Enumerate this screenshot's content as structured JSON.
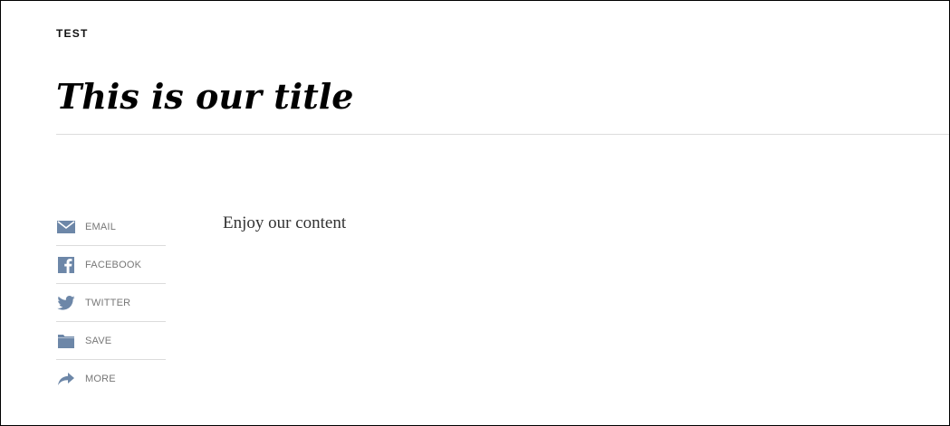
{
  "article": {
    "kicker": "TEST",
    "title": "This is our title",
    "body": "Enjoy our content"
  },
  "share": {
    "icon_color": "#6d87a8",
    "items": [
      {
        "label": "EMAIL",
        "icon": "envelope-icon"
      },
      {
        "label": "FACEBOOK",
        "icon": "facebook-icon"
      },
      {
        "label": "TWITTER",
        "icon": "twitter-bird-icon"
      },
      {
        "label": "SAVE",
        "icon": "folder-icon"
      },
      {
        "label": "MORE",
        "icon": "share-arrow-icon"
      }
    ]
  }
}
